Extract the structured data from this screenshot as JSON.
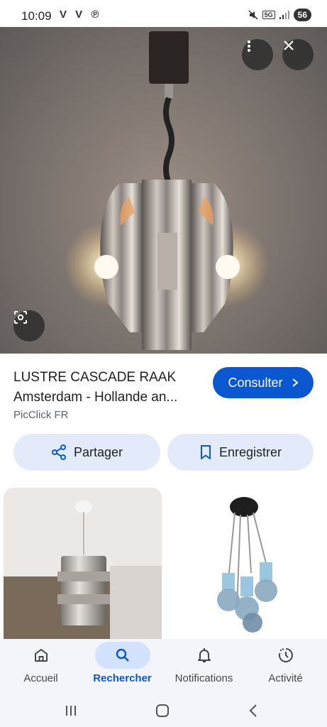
{
  "status_bar": {
    "time": "10:09",
    "app_icons": "V V ℗",
    "network": "5G",
    "battery": "56"
  },
  "hero": {
    "more_icon": "more-vert-icon",
    "close_icon": "close-icon",
    "lens_icon": "lens-search-icon"
  },
  "result": {
    "title": "LUSTRE CASCADE RAAK Amsterdam - Hollande an...",
    "source": "PicClick FR",
    "consult_label": "Consulter",
    "share_label": "Partager",
    "save_label": "Enregistrer"
  },
  "colors": {
    "accent": "#0b57d0",
    "pill_bg": "#e3ebfb",
    "nav_active_bg": "#d3e3fd"
  },
  "bottom_nav": {
    "items": [
      {
        "label": "Accueil",
        "icon": "home-icon"
      },
      {
        "label": "Rechercher",
        "icon": "search-icon",
        "active": true
      },
      {
        "label": "Notifications",
        "icon": "bell-icon"
      },
      {
        "label": "Activité",
        "icon": "activity-icon"
      }
    ]
  },
  "system_nav": {
    "recents_icon": "recents-icon",
    "home_icon": "home-pill-icon",
    "back_icon": "back-icon"
  }
}
